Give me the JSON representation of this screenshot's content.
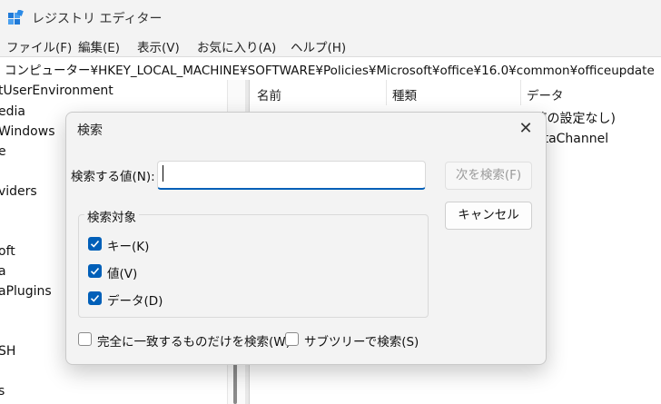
{
  "window": {
    "title": "レジストリ エディター",
    "app_icon": "registry-icon"
  },
  "menu": [
    "ファイル(F)",
    "編集(E)",
    "表示(V)",
    "お気に入り(A)",
    "ヘルプ(H)"
  ],
  "address": "コンピューター¥HKEY_LOCAL_MACHINE¥SOFTWARE¥Policies¥Microsoft¥office¥16.0¥common¥officeupdate",
  "tree": [
    "tUserEnvironment",
    "edia",
    "Windows",
    "e",
    "viders",
    "oft",
    "a",
    "aPlugins",
    "SH",
    "s"
  ],
  "list": {
    "columns": [
      "名前",
      "種類",
      "データ"
    ],
    "rows": [
      {
        "data": "(値の設定なし)"
      },
      {
        "data": "ataChannel"
      }
    ]
  },
  "dialog": {
    "title": "検索",
    "find_label": "検索する値(N):",
    "find_value": "",
    "find_next": "次を検索(F)",
    "cancel": "キャンセル",
    "group_label": "検索対象",
    "options": [
      {
        "label": "キー(K)",
        "checked": true
      },
      {
        "label": "値(V)",
        "checked": true
      },
      {
        "label": "データ(D)",
        "checked": true
      }
    ],
    "match_whole": {
      "label": "完全に一致するものだけを検索(W)",
      "checked": false
    },
    "subtree": {
      "label": "サブツリーで検索(S)",
      "checked": false
    }
  },
  "colors": {
    "accent": "#005fb8"
  }
}
